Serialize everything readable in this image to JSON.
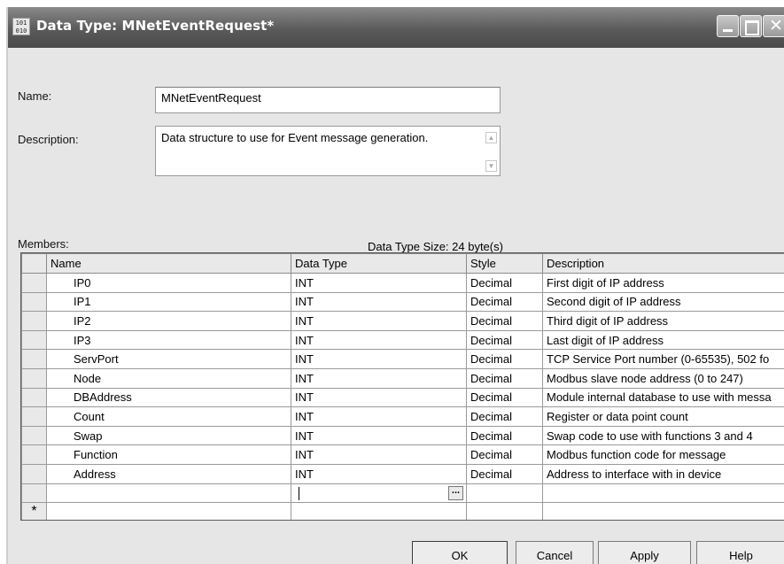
{
  "window": {
    "title": "Data Type:  MNetEventRequest*",
    "icon_text": "101\n010"
  },
  "form": {
    "name_label": "Name:",
    "name_value": "MNetEventRequest",
    "description_label": "Description:",
    "description_value": "Data structure to use for Event message generation."
  },
  "members": {
    "label": "Members:",
    "size_text": "Data Type Size: 24 byte(s)",
    "columns": [
      "Name",
      "Data Type",
      "Style",
      "Description"
    ],
    "rows": [
      {
        "name": "IP0",
        "type": "INT",
        "style": "Decimal",
        "description": "First digit of IP address"
      },
      {
        "name": "IP1",
        "type": "INT",
        "style": "Decimal",
        "description": "Second digit of IP address"
      },
      {
        "name": "IP2",
        "type": "INT",
        "style": "Decimal",
        "description": "Third digit of IP address"
      },
      {
        "name": "IP3",
        "type": "INT",
        "style": "Decimal",
        "description": "Last digit of IP address"
      },
      {
        "name": "ServPort",
        "type": "INT",
        "style": "Decimal",
        "description": "TCP Service Port number (0-65535), 502 fo"
      },
      {
        "name": "Node",
        "type": "INT",
        "style": "Decimal",
        "description": "Modbus slave node address (0 to 247)"
      },
      {
        "name": "DBAddress",
        "type": "INT",
        "style": "Decimal",
        "description": "Module internal database to use with messa"
      },
      {
        "name": "Count",
        "type": "INT",
        "style": "Decimal",
        "description": "Register or data point count"
      },
      {
        "name": "Swap",
        "type": "INT",
        "style": "Decimal",
        "description": "Swap code to use with functions 3 and 4"
      },
      {
        "name": "Function",
        "type": "INT",
        "style": "Decimal",
        "description": "Modbus function code for message"
      },
      {
        "name": "Address",
        "type": "INT",
        "style": "Decimal",
        "description": "Address to interface with in device"
      }
    ],
    "ellipsis_label": "...",
    "new_row_marker": "*"
  },
  "buttons": {
    "ok": "OK",
    "cancel": "Cancel",
    "apply": "Apply",
    "help": "Help"
  },
  "colors": {
    "titlebar": "#5a5a5a",
    "dialog_bg": "#e6e6e6"
  }
}
